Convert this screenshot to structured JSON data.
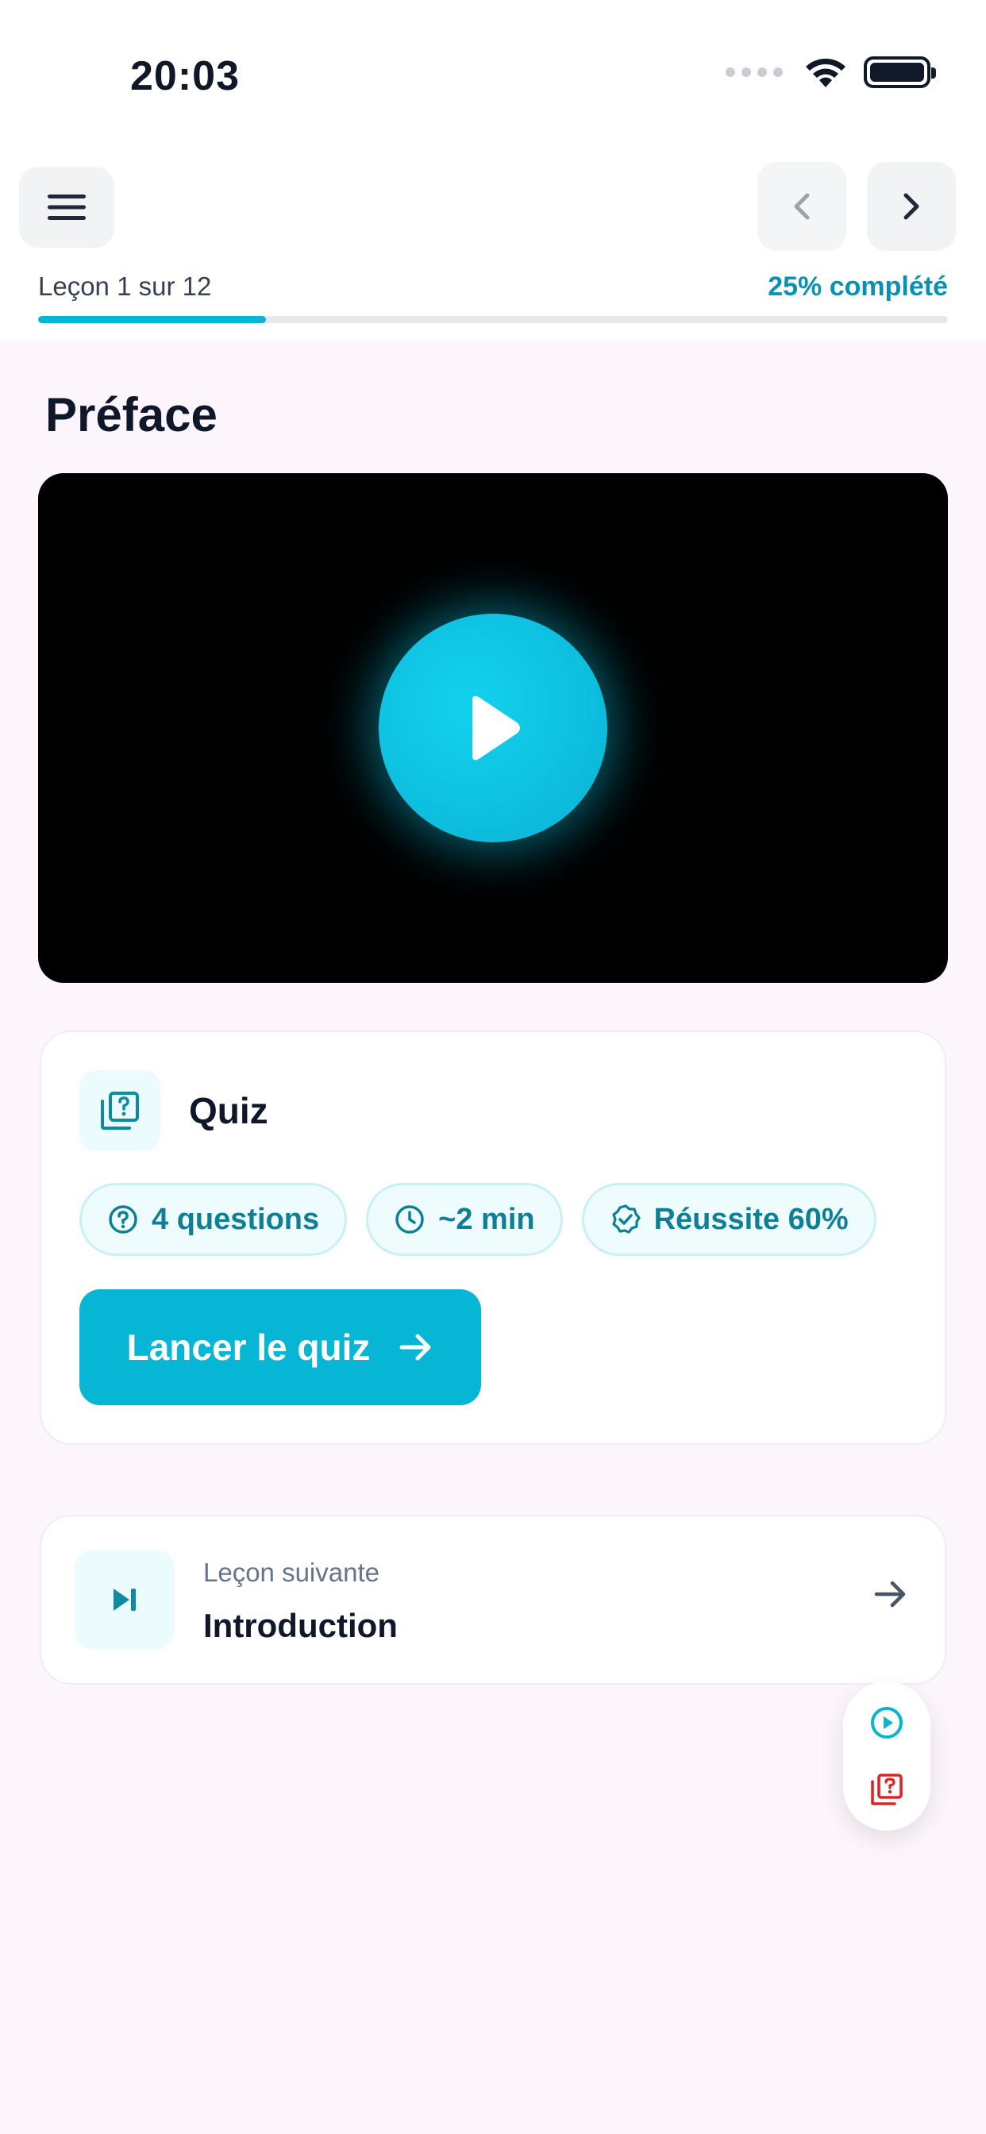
{
  "status_bar": {
    "time": "20:03"
  },
  "header": {
    "lesson_counter": "Leçon 1 sur 12",
    "completion_text": "25% complété",
    "progress_fraction": 0.25
  },
  "lesson": {
    "title": "Préface"
  },
  "quiz": {
    "title": "Quiz",
    "chips": [
      {
        "icon": "question-circle-icon",
        "label": "4 questions"
      },
      {
        "icon": "clock-icon",
        "label": "~2 min"
      },
      {
        "icon": "badge-check-icon",
        "label": "Réussite 60%"
      }
    ],
    "start_label": "Lancer le quiz"
  },
  "next_lesson": {
    "label": "Leçon suivante",
    "title": "Introduction"
  },
  "colors": {
    "accent": "#06b6d4",
    "accent_text": "#0891b2",
    "quiz_red": "#dc2626"
  }
}
